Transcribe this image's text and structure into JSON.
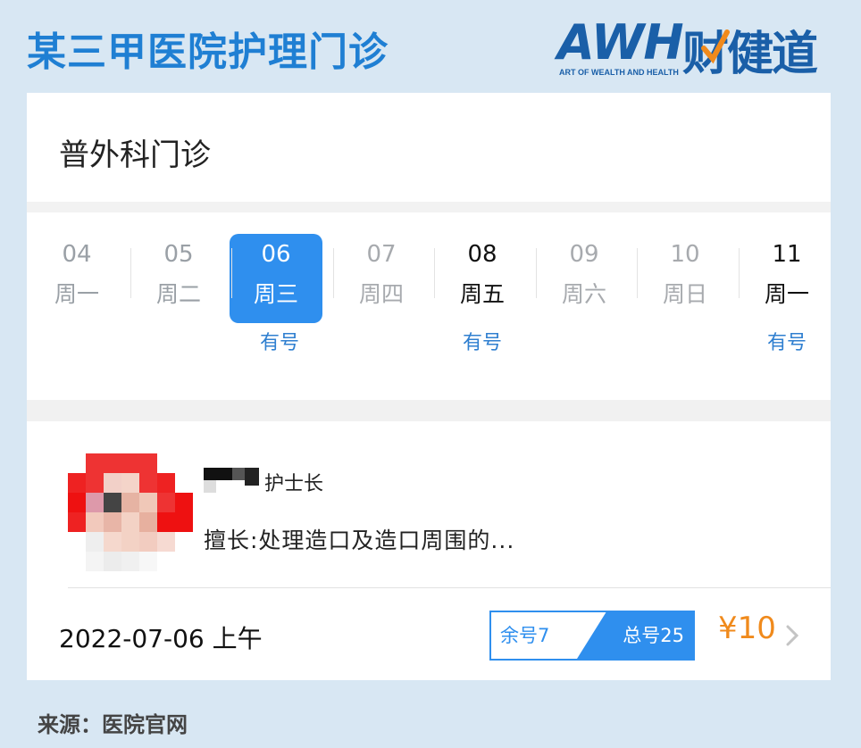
{
  "header": {
    "title": "某三甲医院护理门诊",
    "brand_letters": "AWH",
    "brand_cn": "财健道",
    "brand_sub": "ART OF WEALTH AND HEALTH"
  },
  "department": {
    "title": "普外科门诊"
  },
  "dates": [
    {
      "num": "04",
      "weekday": "周一",
      "state": "past",
      "avail": ""
    },
    {
      "num": "05",
      "weekday": "周二",
      "state": "past",
      "avail": ""
    },
    {
      "num": "06",
      "weekday": "周三",
      "state": "selected",
      "avail": "有号"
    },
    {
      "num": "07",
      "weekday": "周四",
      "state": "empty",
      "avail": ""
    },
    {
      "num": "08",
      "weekday": "周五",
      "state": "future",
      "avail": "有号"
    },
    {
      "num": "09",
      "weekday": "周六",
      "state": "empty",
      "avail": ""
    },
    {
      "num": "10",
      "weekday": "周日",
      "state": "empty",
      "avail": ""
    },
    {
      "num": "11",
      "weekday": "周一",
      "state": "future",
      "avail": "有号"
    }
  ],
  "doctor": {
    "title": "护士长",
    "specialty": "擅长:处理造口及造口周围的..."
  },
  "slot": {
    "date": "2022-07-06 上午",
    "remaining": "余号7",
    "total": "总号25",
    "price": "¥10"
  },
  "footer": {
    "source": "来源：医院官网"
  },
  "colors": {
    "accent": "#2f8fee",
    "title_blue": "#1f7fd3",
    "price": "#f08a1c",
    "background": "#d8e7f3"
  }
}
